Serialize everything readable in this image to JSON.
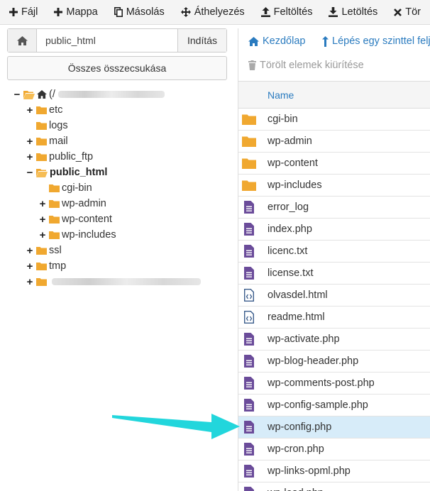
{
  "toolbar": {
    "items": [
      {
        "label": "Fájl",
        "icon": "plus-icon"
      },
      {
        "label": "Mappa",
        "icon": "plus-icon"
      },
      {
        "label": "Másolás",
        "icon": "copy-icon"
      },
      {
        "label": "Áthelyezés",
        "icon": "move-icon"
      },
      {
        "label": "Feltöltés",
        "icon": "upload-icon"
      },
      {
        "label": "Letöltés",
        "icon": "download-icon"
      },
      {
        "label": "Tör",
        "icon": "close-icon"
      }
    ]
  },
  "path": {
    "value": "public_html",
    "go_label": "Indítás"
  },
  "collapse_label": "Összes összecsukása",
  "tree": {
    "root_label": "(/",
    "items": [
      {
        "label": "etc"
      },
      {
        "label": "logs"
      },
      {
        "label": "mail"
      },
      {
        "label": "public_ftp"
      },
      {
        "label": "public_html"
      },
      {
        "label": "cgi-bin"
      },
      {
        "label": "wp-admin"
      },
      {
        "label": "wp-content"
      },
      {
        "label": "wp-includes"
      },
      {
        "label": "ssl"
      },
      {
        "label": "tmp"
      }
    ]
  },
  "right_toolbar": {
    "home_label": "Kezdőlap",
    "up_label": "Lépés egy szinttel feljebb",
    "trash_label": "Törölt elemek kiürítése"
  },
  "table": {
    "header_name": "Name",
    "rows": [
      {
        "name": "cgi-bin",
        "type": "folder"
      },
      {
        "name": "wp-admin",
        "type": "folder"
      },
      {
        "name": "wp-content",
        "type": "folder"
      },
      {
        "name": "wp-includes",
        "type": "folder"
      },
      {
        "name": "error_log",
        "type": "text"
      },
      {
        "name": "index.php",
        "type": "text"
      },
      {
        "name": "licenc.txt",
        "type": "text"
      },
      {
        "name": "license.txt",
        "type": "text"
      },
      {
        "name": "olvasdel.html",
        "type": "html"
      },
      {
        "name": "readme.html",
        "type": "html"
      },
      {
        "name": "wp-activate.php",
        "type": "text"
      },
      {
        "name": "wp-blog-header.php",
        "type": "text"
      },
      {
        "name": "wp-comments-post.php",
        "type": "text"
      },
      {
        "name": "wp-config-sample.php",
        "type": "text"
      },
      {
        "name": "wp-config.php",
        "type": "text",
        "selected": true
      },
      {
        "name": "wp-cron.php",
        "type": "text"
      },
      {
        "name": "wp-links-opml.php",
        "type": "text"
      },
      {
        "name": "wp-load.php",
        "type": "text"
      }
    ]
  },
  "colors": {
    "accent": "#2a7bbf",
    "folder": "#f0a830",
    "file": "#6b4c9a",
    "selected_row": "#d7ecf9",
    "arrow": "#22d6dc"
  }
}
